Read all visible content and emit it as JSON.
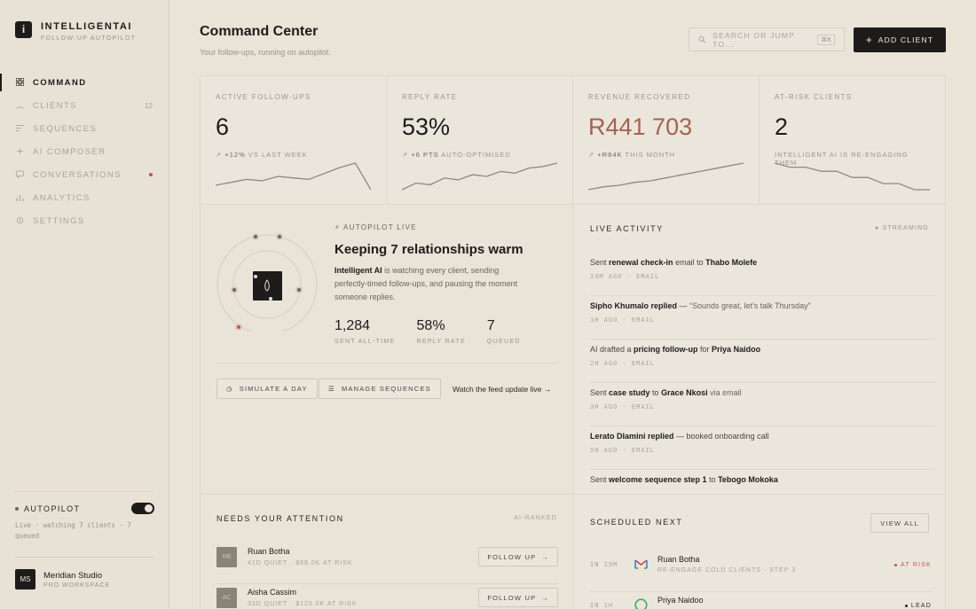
{
  "brand": {
    "name": "INTELLIGENTAI",
    "tagline": "FOLLOW-UP AUTOPILOT",
    "logo_glyph": "i"
  },
  "nav": [
    {
      "label": "COMMAND",
      "icon": "grid-icon",
      "active": true
    },
    {
      "label": "CLIENTS",
      "icon": "user-icon",
      "count": "12"
    },
    {
      "label": "SEQUENCES",
      "icon": "list-icon"
    },
    {
      "label": "AI COMPOSER",
      "icon": "sparkle-icon"
    },
    {
      "label": "CONVERSATIONS",
      "icon": "chat-icon",
      "dot": true
    },
    {
      "label": "ANALYTICS",
      "icon": "bar-chart-icon"
    },
    {
      "label": "SETTINGS",
      "icon": "gear-icon"
    }
  ],
  "autopilot": {
    "label": "AUTOPILOT",
    "status": "Live · watching 7 clients · 7 queued",
    "enabled": true
  },
  "workspace": {
    "initials": "MS",
    "name": "Meridian Studio",
    "plan": "PRO WORKSPACE"
  },
  "header": {
    "title": "Command Center",
    "subtitle": "Your follow-ups, running on autopilot.",
    "search_placeholder": "SEARCH OR JUMP TO...",
    "search_shortcut": "⌘K",
    "add_client_label": "ADD CLIENT"
  },
  "stats": [
    {
      "label": "ACTIVE FOLLOW-UPS",
      "value": "6",
      "delta": "+12%",
      "delta_text": "VS LAST WEEK",
      "spark": [
        10,
        12,
        14,
        13,
        16,
        15,
        14,
        18,
        22,
        25,
        7
      ]
    },
    {
      "label": "REPLY RATE",
      "value": "53%",
      "delta": "+6 PTS",
      "delta_text": "AUTO-OPTIMISED",
      "spark": [
        6,
        10,
        9,
        13,
        12,
        15,
        14,
        17,
        16,
        19,
        20,
        22
      ]
    },
    {
      "label": "REVENUE RECOVERED",
      "value": "R441 703",
      "delta": "+R84K",
      "delta_text": "THIS MONTH",
      "spark": [
        5,
        7,
        8,
        10,
        11,
        13,
        15,
        17,
        19,
        21,
        23
      ],
      "accent": true
    },
    {
      "label": "AT-RISK CLIENTS",
      "value": "2",
      "delta": "",
      "delta_text": "INTELLIGENT AI IS RE-ENGAGING THEM",
      "spark": [
        22,
        20,
        20,
        18,
        18,
        15,
        15,
        12,
        12,
        9,
        9
      ]
    }
  ],
  "autopilot_panel": {
    "tag": "AUTOPILOT LIVE",
    "title": "Keeping 7 relationships warm",
    "desc_bold": "Intelligent AI",
    "desc_rest": " is watching every client, sending perfectly-timed follow-ups, and pausing the moment someone replies.",
    "metrics": [
      {
        "value": "1,284",
        "label": "SENT ALL-TIME"
      },
      {
        "value": "58%",
        "label": "REPLY RATE"
      },
      {
        "value": "7",
        "label": "QUEUED"
      }
    ],
    "simulate_label": "SIMULATE A DAY",
    "manage_label": "MANAGE SEQUENCES",
    "watch_label": "Watch the feed update live →"
  },
  "activity": {
    "title": "LIVE ACTIVITY",
    "status": "STREAMING",
    "items": [
      {
        "pre": "Sent ",
        "bold1": "renewal check-in",
        "mid": " email to ",
        "bold2": "Thabo Molefe",
        "post": "",
        "meta": "24M AGO · EMAIL"
      },
      {
        "pre": "",
        "bold1": "Sipho Khumalo replied",
        "mid": " — ",
        "bold2": "",
        "post": "“Sounds great, let's talk Thursday”",
        "meta": "1H AGO · EMAIL"
      },
      {
        "pre": "AI drafted a ",
        "bold1": "pricing follow-up",
        "mid": " for ",
        "bold2": "Priya Naidoo",
        "post": "",
        "meta": "2H AGO · EMAIL"
      },
      {
        "pre": "Sent ",
        "bold1": "case study",
        "mid": " to ",
        "bold2": "Grace Nkosi",
        "post": " via email",
        "meta": "3H AGO · EMAIL"
      },
      {
        "pre": "",
        "bold1": "Lerato Dlamini replied",
        "mid": " — booked onboarding call",
        "bold2": "",
        "post": "",
        "meta": "5H AGO · EMAIL"
      },
      {
        "pre": "Sent ",
        "bold1": "welcome sequence step 1",
        "mid": " to ",
        "bold2": "Tebogo Mokoka",
        "post": "",
        "meta": ""
      }
    ]
  },
  "attention": {
    "title": "NEEDS YOUR ATTENTION",
    "tag": "AI-RANKED",
    "rows": [
      {
        "initials": "RB",
        "name": "Ruan Botha",
        "meta": "41D QUIET · $88.0K AT RISK",
        "action": "FOLLOW UP"
      },
      {
        "initials": "AC",
        "name": "Aisha Cassim",
        "meta": "33D QUIET · $125.0K AT RISK",
        "action": "FOLLOW UP"
      }
    ]
  },
  "scheduled": {
    "title": "SCHEDULED NEXT",
    "view_all": "VIEW ALL",
    "rows": [
      {
        "time": "IN 29M",
        "channel": "gmail-icon",
        "name": "Ruan Botha",
        "sub": "RE-ENGAGE COLD CLIENTS · STEP 3",
        "badge": "AT RISK",
        "badge_color": "#c0574a"
      },
      {
        "time": "IN 1H",
        "channel": "whatsapp-icon",
        "name": "Priya Naidoo",
        "sub": "",
        "badge": "LEAD",
        "badge_color": "#2a2724"
      }
    ]
  },
  "colors": {
    "accent": "#a6634e",
    "ink": "#1e1c1a",
    "bg": "#e9e3d8",
    "alert": "#c0574a"
  }
}
